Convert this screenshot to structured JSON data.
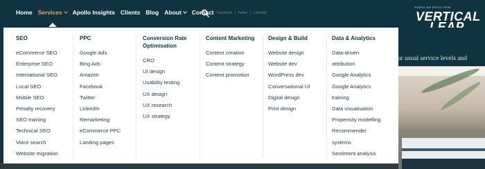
{
  "nav": {
    "items": [
      {
        "label": "Home",
        "dropdown": false,
        "active": false
      },
      {
        "label": "Services",
        "dropdown": true,
        "active": true
      },
      {
        "label": "Apollo Insights",
        "dropdown": false,
        "active": false
      },
      {
        "label": "Clients",
        "dropdown": false,
        "active": false
      },
      {
        "label": "Blog",
        "dropdown": false,
        "active": false
      },
      {
        "label": "About",
        "dropdown": true,
        "active": false
      },
      {
        "label": "Contact",
        "dropdown": false,
        "active": false
      }
    ],
    "social": [
      "Facebook",
      "|",
      "Twitter",
      "|",
      "LinkedIn"
    ]
  },
  "logo": {
    "tagline": "SEARCH AND DIGITAL FROM",
    "line1": "VERTICAL",
    "line2": "LEAP",
    "est": "EST 2007"
  },
  "hero": {
    "tagline": "our usual service levels and"
  },
  "mega_menu": {
    "columns": [
      {
        "heading": "SEO",
        "items": [
          "eCommerce SEO",
          "Enterprise SEO",
          "International SEO",
          "Local SEO",
          "Mobile SEO",
          "Penalty recovery",
          "SEO training",
          "Technical SEO",
          "Voice search",
          "Website migration"
        ]
      },
      {
        "heading": "PPC",
        "items": [
          "Google Ads",
          "Bing Ads",
          "Amazon",
          "Facebook",
          "Twitter",
          "LinkedIn",
          "Remarketing",
          "eCommerce PPC",
          "Landing pages"
        ]
      },
      {
        "heading": "Conversion Rate Optimisation",
        "items": [
          "CRO",
          "UI design",
          "Usability testing",
          "UX design",
          "UX research",
          "UX strategy"
        ]
      },
      {
        "heading": "Content Marketing",
        "items": [
          "Content creation",
          "Content strategy",
          "Content promotion"
        ]
      },
      {
        "heading": "Design & Build",
        "items": [
          "Website design",
          "Website dev",
          "WordPress dev",
          "Conversational UI",
          "Digital design",
          "Print design"
        ]
      },
      {
        "heading": "Data & Analytics",
        "items": [
          "Data-driven",
          "attribution",
          "Google Analytics",
          "Google Analytics",
          "training",
          "Data visualisation",
          "Propensity modelling",
          "Recommender",
          "systems",
          "Sentiment analysis"
        ]
      }
    ]
  },
  "colors": {
    "header_bg": "#0f3340",
    "active_nav": "#f0a35e",
    "menu_text": "#1d3b47"
  }
}
